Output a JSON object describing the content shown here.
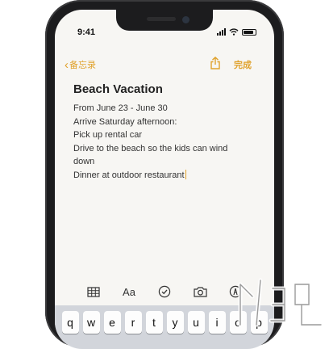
{
  "status_bar": {
    "time": "9:41"
  },
  "nav": {
    "back_label": "备忘录",
    "done_label": "完成"
  },
  "note": {
    "title": "Beach Vacation",
    "lines": [
      "From June 23 - June 30",
      "Arrive Saturday afternoon:",
      "Pick up rental car",
      "Drive to the beach so the kids can wind",
      "down",
      "Dinner at outdoor restaurant"
    ]
  },
  "toolbar": {
    "format_label": "Aa"
  },
  "keyboard": {
    "keys": [
      "q",
      "w",
      "e",
      "r",
      "t",
      "y",
      "u",
      "i",
      "o",
      "p"
    ]
  },
  "colors": {
    "accent": "#e0a22d",
    "paper": "#f7f6f3",
    "keyboard": "#d2d5db"
  },
  "icons": [
    "table-icon",
    "text-format-icon",
    "checklist-icon",
    "camera-icon",
    "markup-icon",
    "share-icon",
    "back-chevron-icon"
  ]
}
